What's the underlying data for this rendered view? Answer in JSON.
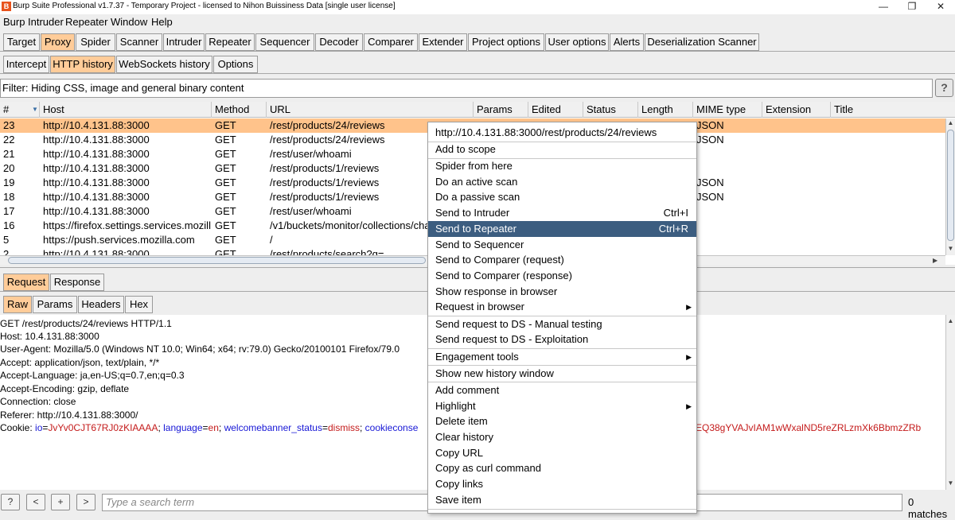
{
  "window": {
    "title": "Burp Suite Professional v1.7.37 - Temporary Project - licensed to Nihon Buissiness Data [single user license]",
    "minimize": "—",
    "maximize": "❐",
    "close": "✕"
  },
  "menubar": [
    "Burp",
    "Intruder",
    "Repeater",
    "Window",
    "Help"
  ],
  "main_tabs": [
    "Target",
    "Proxy",
    "Spider",
    "Scanner",
    "Intruder",
    "Repeater",
    "Sequencer",
    "Decoder",
    "Comparer",
    "Extender",
    "Project options",
    "User options",
    "Alerts",
    "Deserialization Scanner"
  ],
  "main_tab_selected": "Proxy",
  "proxy_tabs": [
    "Intercept",
    "HTTP history",
    "WebSockets history",
    "Options"
  ],
  "proxy_tab_selected": "HTTP history",
  "filter_text": "Filter: Hiding CSS, image and general binary content",
  "help_label": "?",
  "table": {
    "sort_indicator": "▼",
    "columns": [
      "#",
      "Host",
      "Method",
      "URL",
      "Params",
      "Edited",
      "Status",
      "Length",
      "MIME type",
      "Extension",
      "Title"
    ],
    "rows": [
      {
        "num": "23",
        "host": "http://10.4.131.88:3000",
        "method": "GET",
        "url": "/rest/products/24/reviews",
        "mime": "JSON"
      },
      {
        "num": "22",
        "host": "http://10.4.131.88:3000",
        "method": "GET",
        "url": "/rest/products/24/reviews",
        "mime": "JSON"
      },
      {
        "num": "21",
        "host": "http://10.4.131.88:3000",
        "method": "GET",
        "url": "/rest/user/whoami",
        "mime": ""
      },
      {
        "num": "20",
        "host": "http://10.4.131.88:3000",
        "method": "GET",
        "url": "/rest/products/1/reviews",
        "mime": ""
      },
      {
        "num": "19",
        "host": "http://10.4.131.88:3000",
        "method": "GET",
        "url": "/rest/products/1/reviews",
        "mime": "JSON"
      },
      {
        "num": "18",
        "host": "http://10.4.131.88:3000",
        "method": "GET",
        "url": "/rest/products/1/reviews",
        "mime": "JSON"
      },
      {
        "num": "17",
        "host": "http://10.4.131.88:3000",
        "method": "GET",
        "url": "/rest/user/whoami",
        "mime": ""
      },
      {
        "num": "16",
        "host": "https://firefox.settings.services.mozill...",
        "method": "GET",
        "url": "/v1/buckets/monitor/collections/chang",
        "mime": ""
      },
      {
        "num": "5",
        "host": "https://push.services.mozilla.com",
        "method": "GET",
        "url": "/",
        "mime": ""
      },
      {
        "num": "2",
        "host": "http://10.4.131.88:3000",
        "method": "GET",
        "url": "/rest/products/search?q=",
        "mime": ""
      }
    ]
  },
  "message_tabs": [
    "Request",
    "Response"
  ],
  "message_tab_selected": "Request",
  "view_tabs": [
    "Raw",
    "Params",
    "Headers",
    "Hex"
  ],
  "view_tab_selected": "Raw",
  "request_lines": [
    "GET /rest/products/24/reviews HTTP/1.1",
    "Host: 10.4.131.88:3000",
    "User-Agent: Mozilla/5.0 (Windows NT 10.0; Win64; x64; rv:79.0) Gecko/20100101 Firefox/79.0",
    "Accept: application/json, text/plain, */*",
    "Accept-Language: ja,en-US;q=0.7,en;q=0.3",
    "Accept-Encoding: gzip, deflate",
    "Connection: close",
    "Referer: http://10.4.131.88:3000/"
  ],
  "cookie": {
    "label": "Cookie: ",
    "c1_name": "io",
    "c1_val": "JvYv0CJT67RJ0zKIAAAA",
    "c2_name": "language",
    "c2_val": "en",
    "c3_name": "welcomebanner_status",
    "c3_val": "dismiss",
    "c4_name": "cookieconse",
    "tail_val": "EQ38gYVAJvIAM1wWxalND5reZRLzmXk6BbmzZRb"
  },
  "search": {
    "help": "?",
    "prev": "<",
    "add": "+",
    "next": ">",
    "placeholder": "Type a search term",
    "matches": "0 matches"
  },
  "context_menu": {
    "header": "http://10.4.131.88:3000/rest/products/24/reviews",
    "items": [
      {
        "label": "Add to scope"
      },
      {
        "label": "Spider from here"
      },
      {
        "label": "Do an active scan"
      },
      {
        "label": "Do a passive scan"
      },
      {
        "label": "Send to Intruder",
        "shortcut": "Ctrl+I"
      },
      {
        "label": "Send to Repeater",
        "shortcut": "Ctrl+R"
      },
      {
        "label": "Send to Sequencer"
      },
      {
        "label": "Send to Comparer (request)"
      },
      {
        "label": "Send to Comparer (response)"
      },
      {
        "label": "Show response in browser"
      },
      {
        "label": "Request in browser"
      },
      {
        "label": "Send request to DS - Manual testing"
      },
      {
        "label": "Send request to DS - Exploitation"
      },
      {
        "label": "Engagement tools"
      },
      {
        "label": "Show new history window"
      },
      {
        "label": "Add comment"
      },
      {
        "label": "Highlight"
      },
      {
        "label": "Delete item"
      },
      {
        "label": "Clear history"
      },
      {
        "label": "Copy URL"
      },
      {
        "label": "Copy as curl command"
      },
      {
        "label": "Copy links"
      },
      {
        "label": "Save item"
      }
    ],
    "highlighted": "Send to Repeater",
    "submenu_arrow": "▶"
  }
}
